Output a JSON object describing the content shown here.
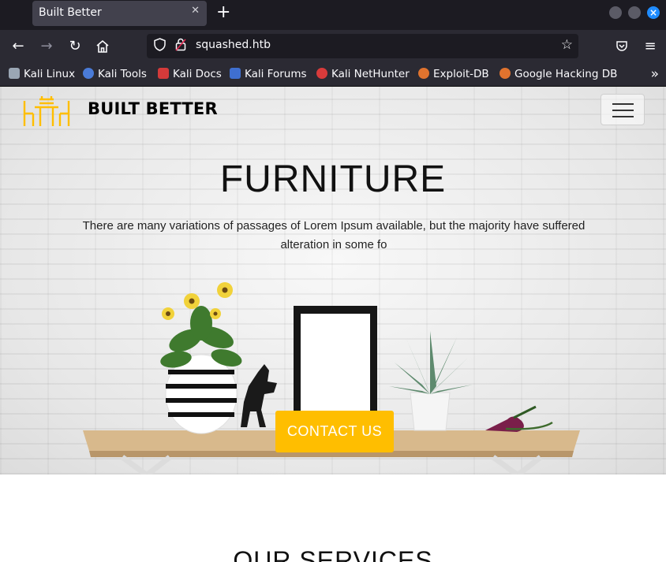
{
  "browser": {
    "tab_title": "Built Better",
    "tab_close": "✕",
    "new_tab": "+",
    "url": "squashed.htb",
    "bookmarks": [
      {
        "label": "Kali Linux",
        "icon": "kali-dragon-icon",
        "color": "#9aa6b4"
      },
      {
        "label": "Kali Tools",
        "icon": "kali-tools-icon",
        "color": "#4a7bd8"
      },
      {
        "label": "Kali Docs",
        "icon": "kali-docs-icon",
        "color": "#d43a3a"
      },
      {
        "label": "Kali Forums",
        "icon": "kali-forums-icon",
        "color": "#3f6fd0"
      },
      {
        "label": "Kali NetHunter",
        "icon": "kali-nethunter-icon",
        "color": "#d83b3b"
      },
      {
        "label": "Exploit-DB",
        "icon": "exploitdb-icon",
        "color": "#e0732e"
      },
      {
        "label": "Google Hacking DB",
        "icon": "ghdb-icon",
        "color": "#e0732e"
      }
    ]
  },
  "site": {
    "brand": "BUILT BETTER",
    "hero_title": "FURNITURE",
    "hero_text": "There are many variations of passages of Lorem Ipsum available, but the majority have suffered alteration in some fo",
    "cta_label": "CONTACT US",
    "services_title": "OUR SERVICES"
  },
  "colors": {
    "accent": "#ffbe00",
    "chrome_dark": "#1c1b22",
    "chrome": "#2b2a33"
  }
}
